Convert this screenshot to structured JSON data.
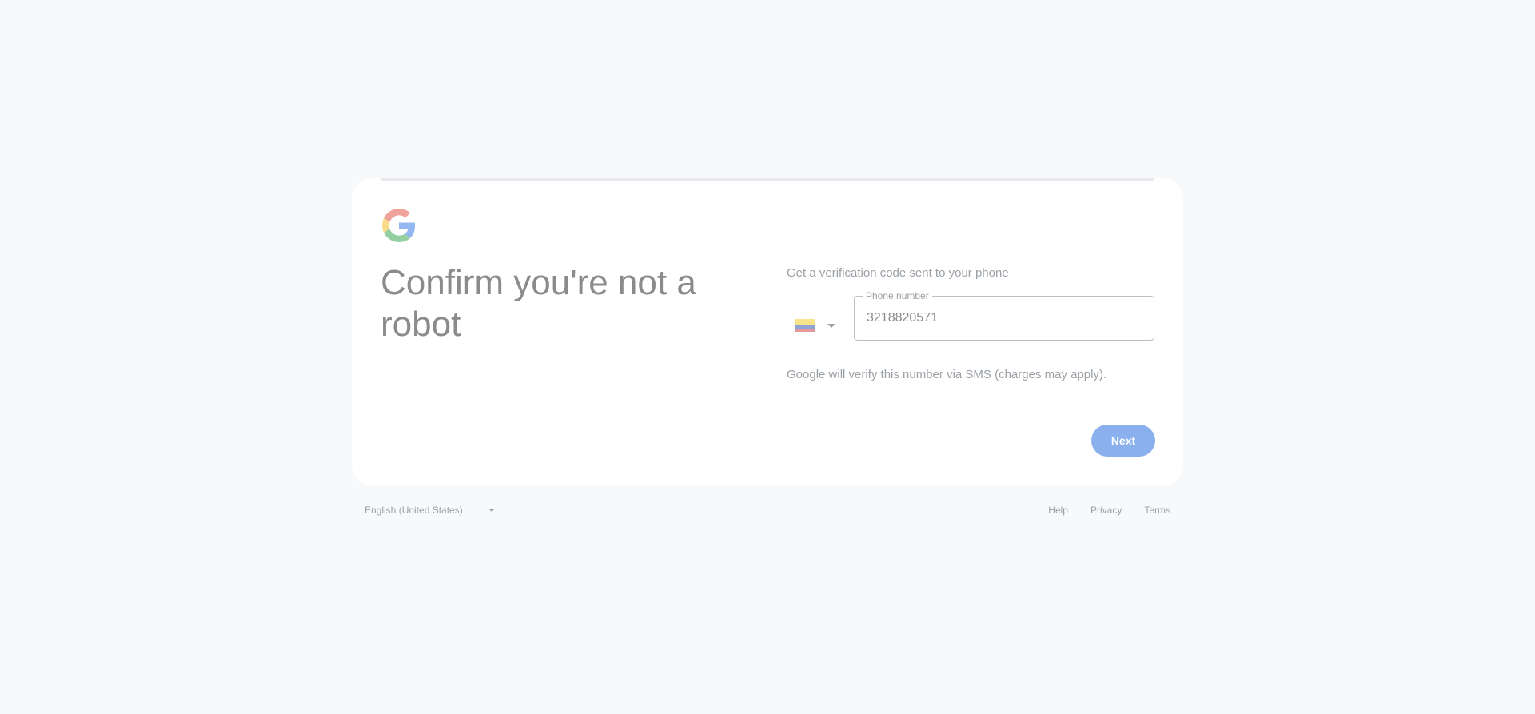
{
  "colors": {
    "background": "#f8f9fa",
    "card": "#ffffff",
    "title_text": "#8a8b8d",
    "muted_text": "#9aa0a6",
    "button": "#8ab0ed",
    "google_red": "#f0a39b",
    "google_yellow": "#f8dc8a",
    "google_green": "#93cfa1",
    "google_blue": "#94b7f2"
  },
  "header": {
    "logo_icon": "google-g-logo-icon",
    "title": "Confirm you're not a robot"
  },
  "form": {
    "prompt": "Get a verification code sent to your phone",
    "country": {
      "flag_icon": "colombia-flag-icon",
      "flag_colors": [
        "#f7e38a",
        "#8fa3d6",
        "#e49a9a"
      ]
    },
    "phone": {
      "label": "Phone number",
      "value": "3218820571"
    },
    "notice": "Google will verify this number via SMS (charges may apply).",
    "next_label": "Next"
  },
  "footer": {
    "language": "English (United States)",
    "links": [
      "Help",
      "Privacy",
      "Terms"
    ]
  }
}
